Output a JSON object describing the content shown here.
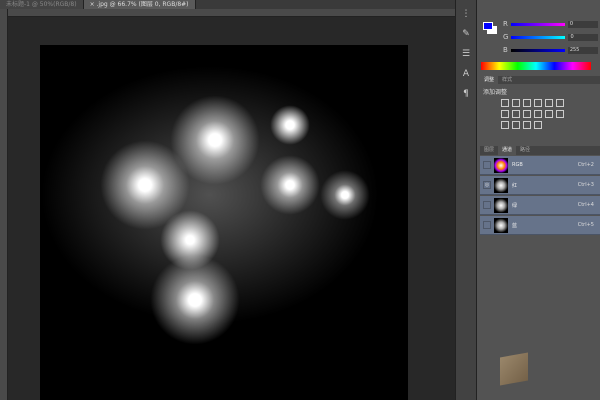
{
  "document_tabs": [
    {
      "label": "未标题-1 @ 50%(RGB/8)",
      "active": false
    },
    {
      "label": "× .jpg @ 66.7% (图层 0, RGB/8#)",
      "active": true
    }
  ],
  "color_panel": {
    "foreground": "#0000ff",
    "background": "#ffffff",
    "channels": [
      {
        "label": "R",
        "value": "0"
      },
      {
        "label": "G",
        "value": "0"
      },
      {
        "label": "B",
        "value": "255"
      }
    ]
  },
  "adjust_panel": {
    "tabs": [
      "调整",
      "样式"
    ],
    "title": "添加调整"
  },
  "channels_panel": {
    "tabs": [
      "图层",
      "通道",
      "路径"
    ],
    "active_tab": "通道",
    "rows": [
      {
        "name": "RGB",
        "shortcut": "Ctrl+2"
      },
      {
        "name": "红",
        "shortcut": "Ctrl+3"
      },
      {
        "name": "绿",
        "shortcut": "Ctrl+4"
      },
      {
        "name": "蓝",
        "shortcut": "Ctrl+5"
      }
    ]
  },
  "colors": {
    "panel_bg": "#535353",
    "channel_row": "#66738a",
    "workspace": "#282828"
  }
}
